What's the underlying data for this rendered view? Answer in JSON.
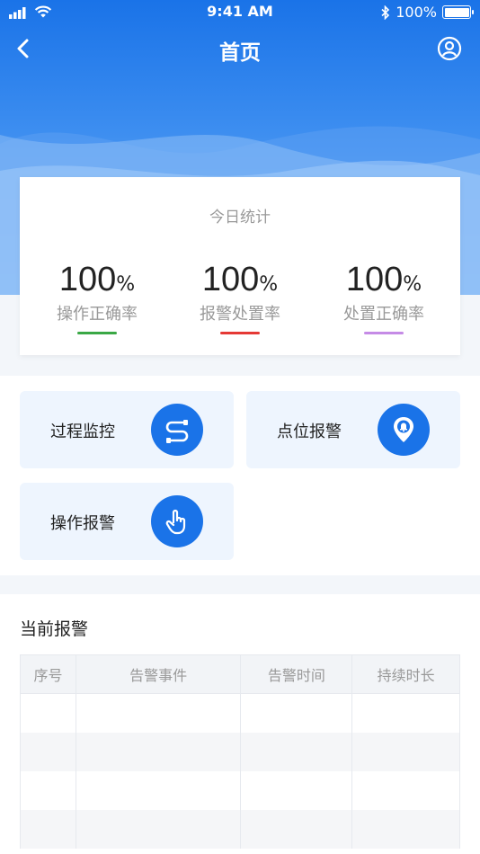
{
  "status_bar": {
    "time": "9:41 AM",
    "battery": "100%"
  },
  "nav": {
    "title": "首页"
  },
  "stats": {
    "title": "今日统计",
    "items": [
      {
        "value": "100",
        "unit": "%",
        "label": "操作正确率",
        "color": "#3aa845"
      },
      {
        "value": "100",
        "unit": "%",
        "label": "报警处置率",
        "color": "#e53935"
      },
      {
        "value": "100",
        "unit": "%",
        "label": "处置正确率",
        "color": "#c58be6"
      }
    ]
  },
  "tiles": [
    {
      "label": "过程监控",
      "icon": "process-icon"
    },
    {
      "label": "点位报警",
      "icon": "location-bell-icon"
    },
    {
      "label": "操作报警",
      "icon": "hand-pointer-icon"
    }
  ],
  "alarms": {
    "title": "当前报警",
    "columns": [
      "序号",
      "告警事件",
      "告警时间",
      "持续时长"
    ],
    "rows": []
  },
  "colors": {
    "primary": "#1a73e8",
    "tile_bg": "#eef5fe"
  }
}
